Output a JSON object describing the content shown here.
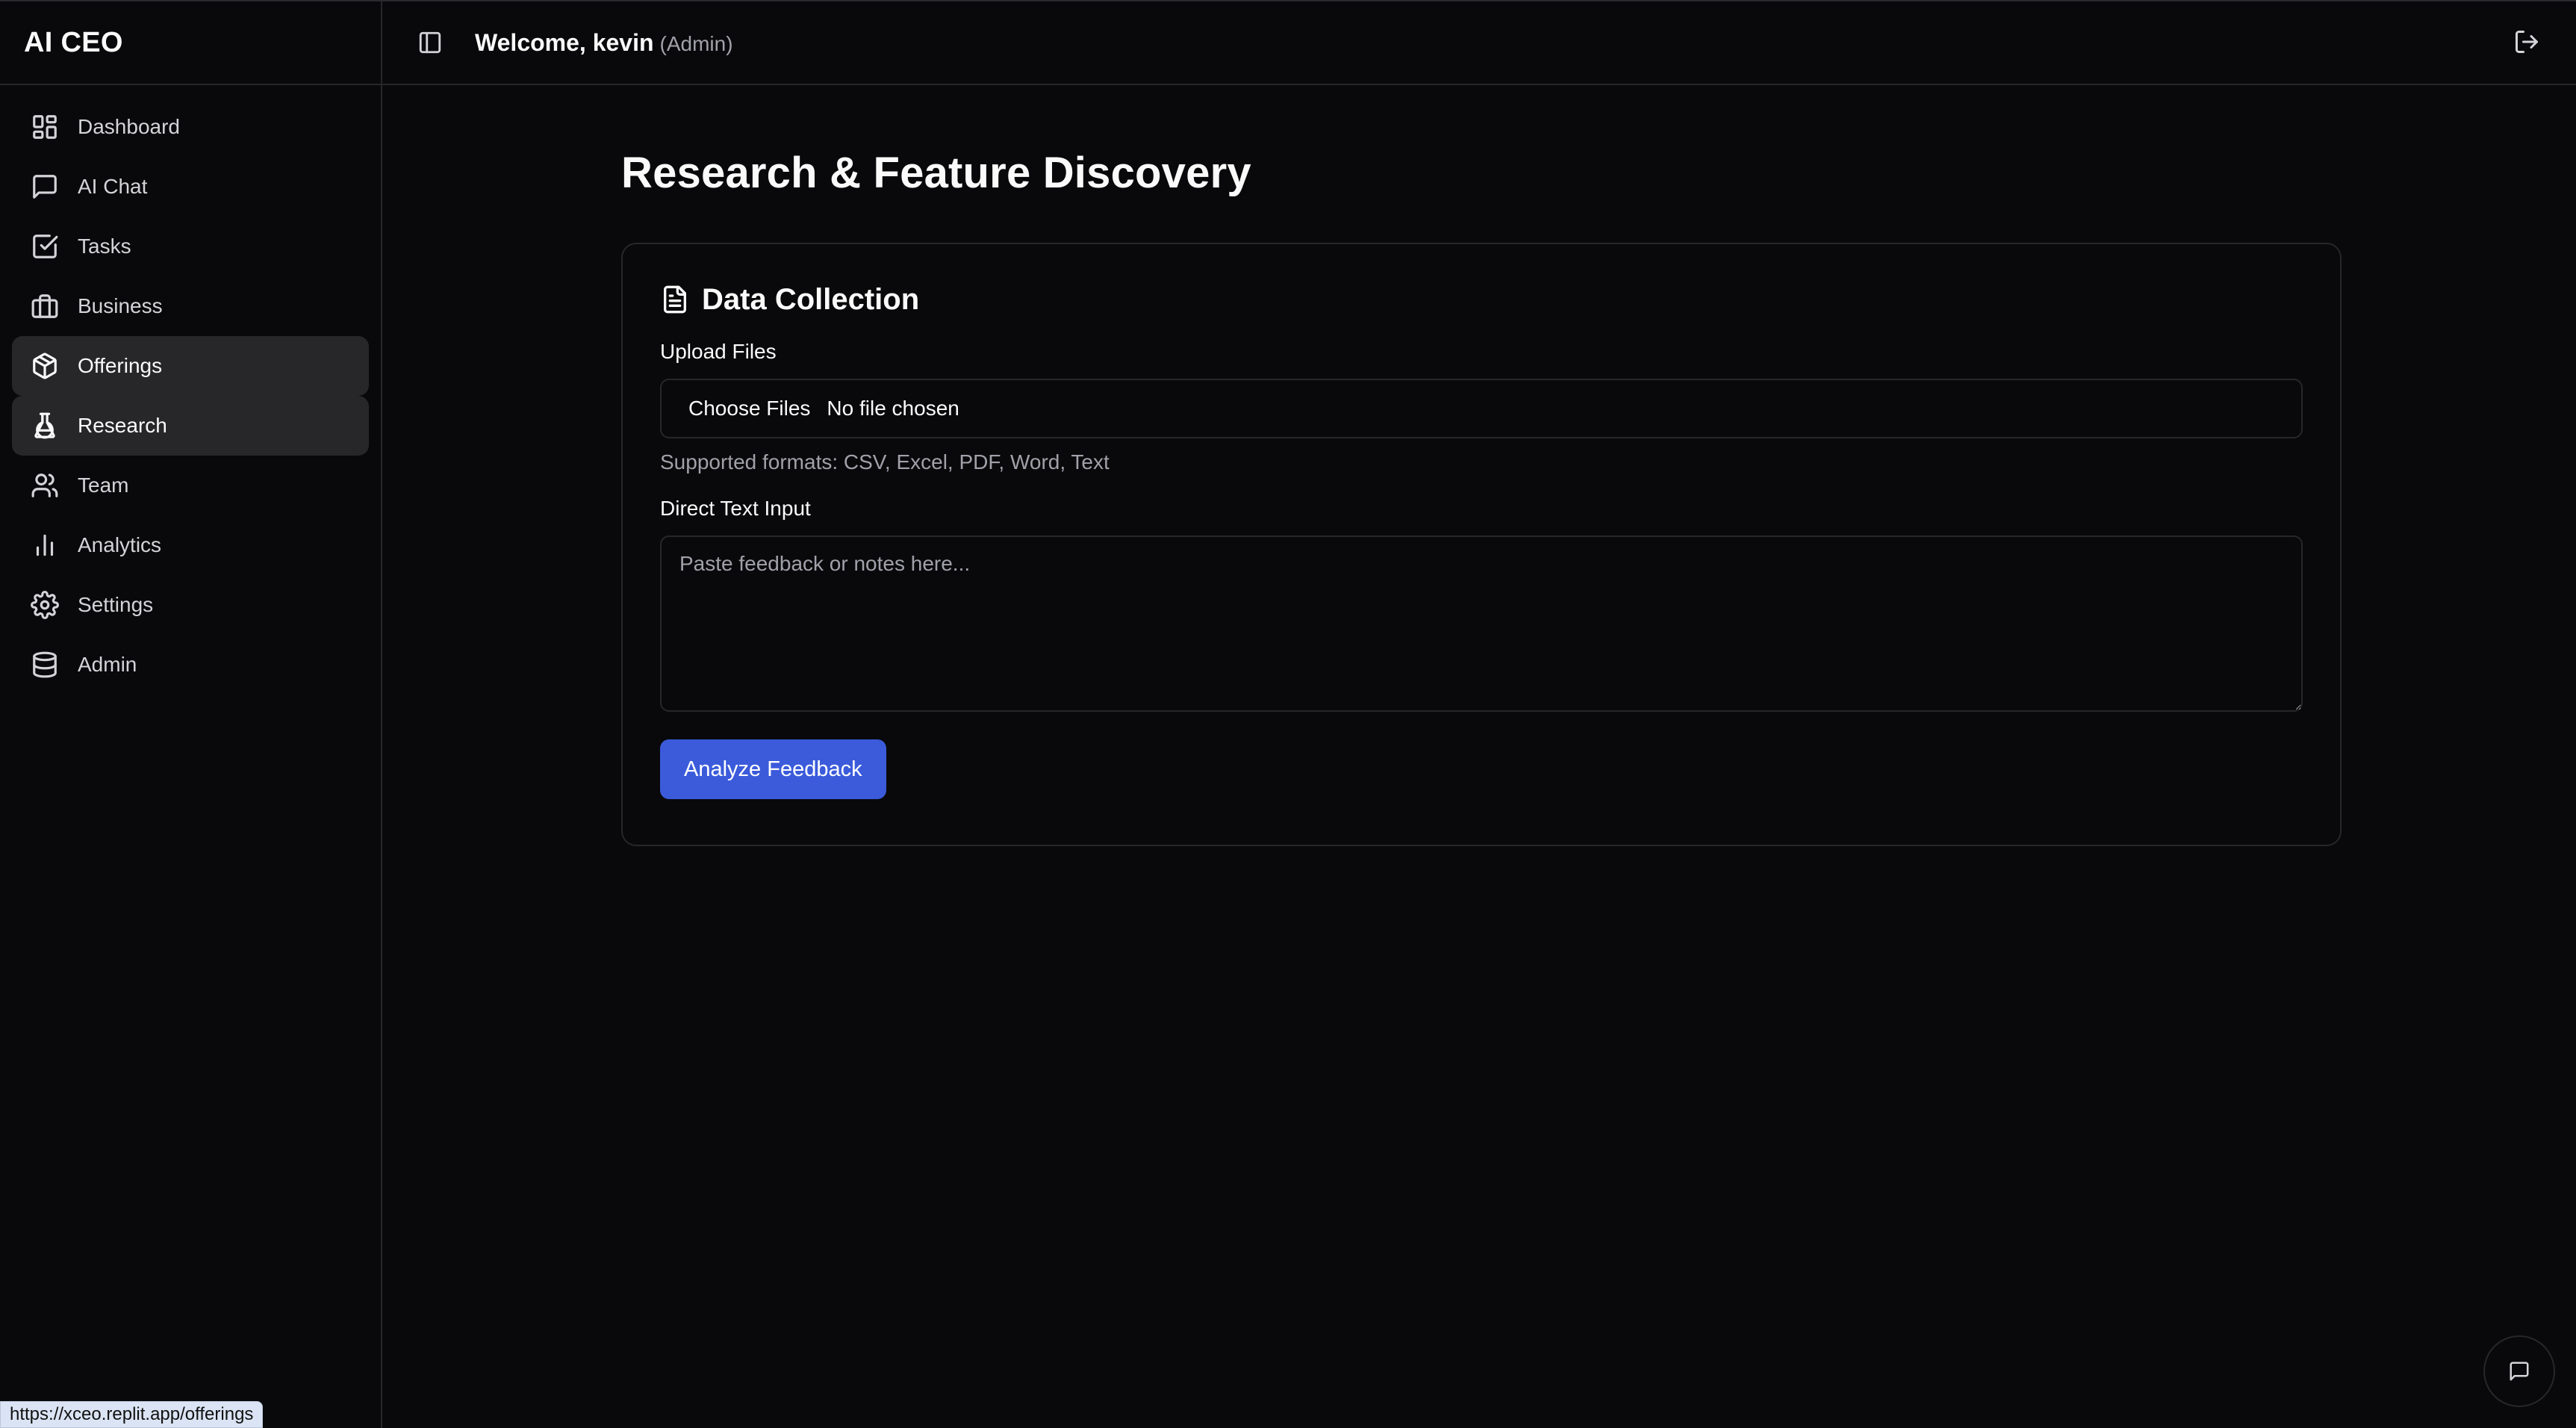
{
  "brand": {
    "name": "AI CEO"
  },
  "header": {
    "welcome": "Welcome, kevin",
    "role": "(Admin)"
  },
  "sidebar": {
    "items": [
      {
        "label": "Dashboard",
        "icon": "dashboard-icon",
        "active": false
      },
      {
        "label": "AI Chat",
        "icon": "chat-icon",
        "active": false
      },
      {
        "label": "Tasks",
        "icon": "tasks-icon",
        "active": false
      },
      {
        "label": "Business",
        "icon": "briefcase-icon",
        "active": false
      },
      {
        "label": "Offerings",
        "icon": "package-icon",
        "active": true
      },
      {
        "label": "Research",
        "icon": "flask-icon",
        "active": true
      },
      {
        "label": "Team",
        "icon": "users-icon",
        "active": false
      },
      {
        "label": "Analytics",
        "icon": "bar-chart-icon",
        "active": false
      },
      {
        "label": "Settings",
        "icon": "gear-icon",
        "active": false
      },
      {
        "label": "Admin",
        "icon": "database-icon",
        "active": false
      }
    ]
  },
  "main": {
    "title": "Research & Feature Discovery",
    "card": {
      "title": "Data Collection",
      "upload_label": "Upload Files",
      "choose_files": "Choose Files",
      "file_status": "No file chosen",
      "hint": "Supported formats: CSV, Excel, PDF, Word, Text",
      "text_label": "Direct Text Input",
      "text_placeholder": "Paste feedback or notes here...",
      "analyze_button": "Analyze Feedback"
    }
  },
  "status_url": "https://xceo.replit.app/offerings",
  "colors": {
    "background": "#09090b",
    "border": "#27272a",
    "accent": "#3b5bdb",
    "active_bg": "#27272a"
  }
}
